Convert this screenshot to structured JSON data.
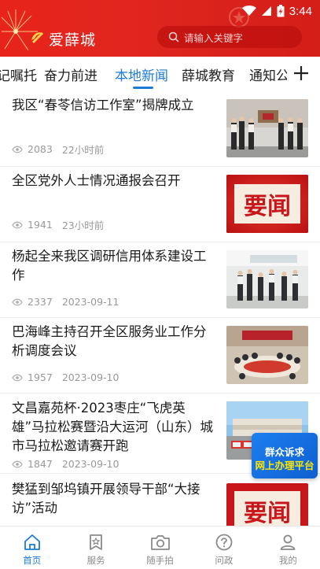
{
  "status_bar": {
    "time": "3:44"
  },
  "header": {
    "brand": "爱薛城",
    "search_placeholder": "请输入关键字",
    "theme_color": "#e8231b"
  },
  "tabs": {
    "items": [
      {
        "label": "记嘱托"
      },
      {
        "label": "奋力前进"
      },
      {
        "label": "本地新闻",
        "active": true
      },
      {
        "label": "薛城教育"
      },
      {
        "label": "通知公"
      }
    ],
    "active_color": "#1b7bd6",
    "add_icon": "plus-icon"
  },
  "news": [
    {
      "title": "我区“春苓信访工作室”揭牌成立",
      "views": "2083",
      "time": "22小时前",
      "thumb": "photo-ceremony"
    },
    {
      "title": "全区党外人士情况通报会召开",
      "views": "1941",
      "time": "23小时前",
      "thumb": "yaowen",
      "thumb_text": "要闻"
    },
    {
      "title": "杨起全来我区调研信用体系建设工作",
      "views": "2337",
      "time": "2023-09-11",
      "thumb": "photo-visit"
    },
    {
      "title": "巴海峰主持召开全区服务业工作分析调度会议",
      "views": "1957",
      "time": "2023-09-10",
      "thumb": "photo-meeting"
    },
    {
      "title": "文昌嘉苑杯·2023枣庄“飞虎英雄”马拉松赛暨沿大运河（山东）城市马拉松邀请赛开跑",
      "views": "1847",
      "time": "2023-09-10",
      "thumb": "photo-marathon"
    },
    {
      "title": "樊猛到邹坞镇开展领导干部“大接访”活动",
      "views": "",
      "time": "",
      "thumb": "yaowen",
      "thumb_text": "要闻"
    }
  ],
  "float_badge": {
    "line1": "群众诉求",
    "line2": "网上办理平台"
  },
  "bottom_nav": [
    {
      "label": "首页",
      "icon": "home-icon",
      "active": true
    },
    {
      "label": "服务",
      "icon": "service-icon"
    },
    {
      "label": "随手拍",
      "icon": "camera-icon"
    },
    {
      "label": "问政",
      "icon": "question-icon"
    },
    {
      "label": "我的",
      "icon": "user-icon"
    }
  ]
}
